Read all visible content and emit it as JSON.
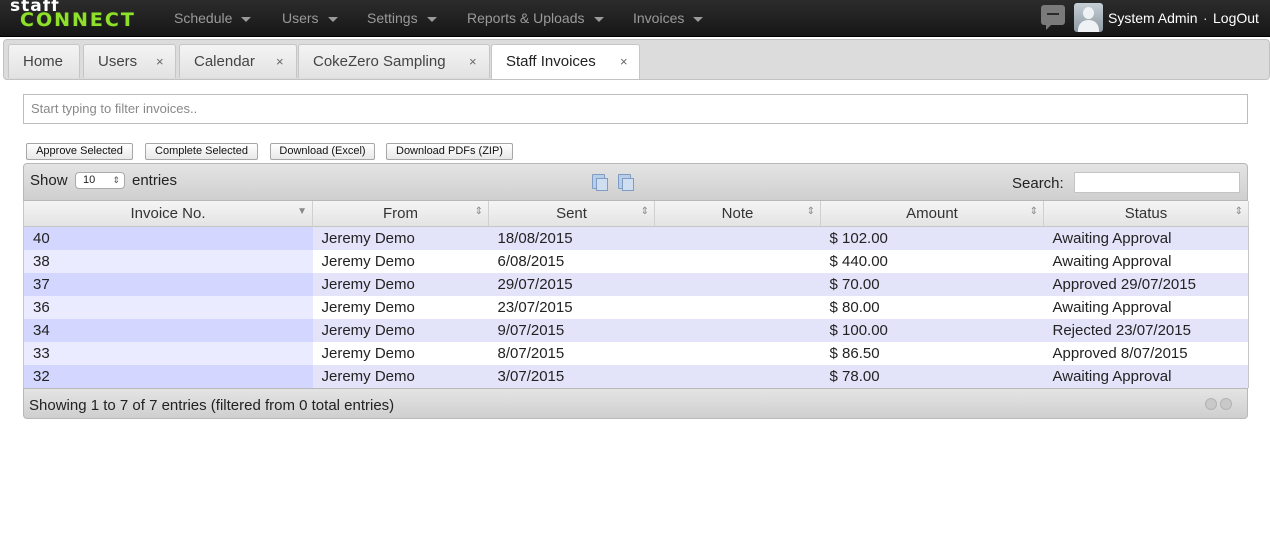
{
  "brand": {
    "line1": "staff",
    "line2": "CONNECT"
  },
  "nav": {
    "menu": [
      {
        "label": "Schedule"
      },
      {
        "label": "Users"
      },
      {
        "label": "Settings"
      },
      {
        "label": "Reports & Uploads"
      },
      {
        "label": "Invoices"
      }
    ],
    "user_name": "System Admin",
    "separator": "·",
    "logout": "LogOut"
  },
  "tabs": [
    {
      "label": "Home",
      "closable": false
    },
    {
      "label": "Users",
      "closable": true
    },
    {
      "label": "Calendar",
      "closable": true
    },
    {
      "label": "CokeZero Sampling",
      "closable": true
    },
    {
      "label": "Staff Invoices",
      "closable": true,
      "active": true
    }
  ],
  "tab_close_glyph": "×",
  "filter": {
    "placeholder": "Start typing to filter invoices.."
  },
  "actions": {
    "approve": "Approve Selected",
    "complete": "Complete Selected",
    "download_excel": "Download (Excel)",
    "download_pdfs": "Download PDFs (ZIP)"
  },
  "table": {
    "show_label": "Show",
    "page_length": "10",
    "entries_label": "entries",
    "search_label": "Search:",
    "columns": [
      "Invoice No.",
      "From",
      "Sent",
      "Note",
      "Amount",
      "Status"
    ],
    "rows": [
      [
        "40",
        "Jeremy Demo",
        "18/08/2015",
        "",
        "$ 102.00",
        "Awaiting Approval"
      ],
      [
        "38",
        "Jeremy Demo",
        "6/08/2015",
        "",
        "$ 440.00",
        "Awaiting Approval"
      ],
      [
        "37",
        "Jeremy Demo",
        "29/07/2015",
        "",
        "$ 70.00",
        "Approved 29/07/2015"
      ],
      [
        "36",
        "Jeremy Demo",
        "23/07/2015",
        "",
        "$ 80.00",
        "Awaiting Approval"
      ],
      [
        "34",
        "Jeremy Demo",
        "9/07/2015",
        "",
        "$ 100.00",
        "Rejected 23/07/2015"
      ],
      [
        "33",
        "Jeremy Demo",
        "8/07/2015",
        "",
        "$ 86.50",
        "Approved 8/07/2015"
      ],
      [
        "32",
        "Jeremy Demo",
        "3/07/2015",
        "",
        "$ 78.00",
        "Awaiting Approval"
      ]
    ],
    "info": "Showing 1 to 7 of 7 entries (filtered from 0 total entries)"
  },
  "icons": {
    "tabletools": [
      "select-all-icon",
      "copy-icon"
    ],
    "pagination": [
      "prev-page-icon",
      "next-page-icon"
    ]
  }
}
